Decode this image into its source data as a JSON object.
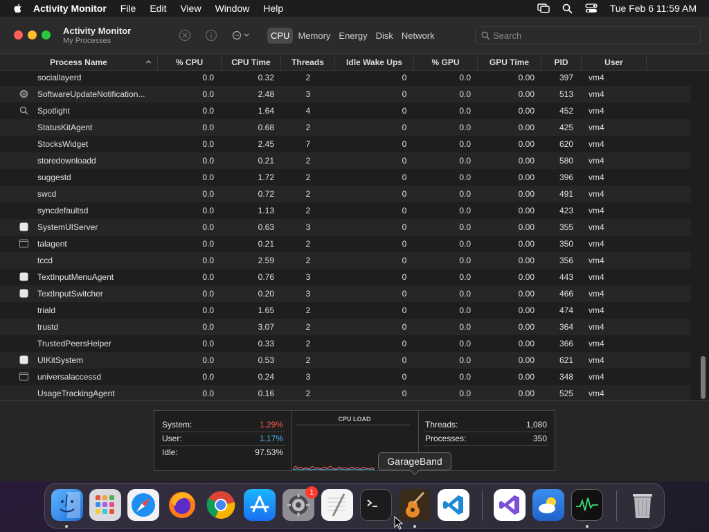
{
  "menubar": {
    "app_name": "Activity Monitor",
    "items": [
      "File",
      "Edit",
      "View",
      "Window",
      "Help"
    ],
    "clock": "Tue Feb 6  11:59 AM"
  },
  "window": {
    "title": "Activity Monitor",
    "subtitle": "My Processes",
    "tabs": [
      "CPU",
      "Memory",
      "Energy",
      "Disk",
      "Network"
    ],
    "active_tab": "CPU",
    "search_placeholder": "Search"
  },
  "columns": [
    "Process Name",
    "% CPU",
    "CPU Time",
    "Threads",
    "Idle Wake Ups",
    "% GPU",
    "GPU Time",
    "PID",
    "User"
  ],
  "rows": [
    {
      "name": "sociallayerd",
      "cpu": "0.0",
      "cpu_time": "0.32",
      "threads": "2",
      "idle": "0",
      "gpu": "0.0",
      "gpu_time": "0.00",
      "pid": "397",
      "user": "vm4",
      "icon": "none"
    },
    {
      "name": "SoftwareUpdateNotification...",
      "cpu": "0.0",
      "cpu_time": "2.48",
      "threads": "3",
      "idle": "0",
      "gpu": "0.0",
      "gpu_time": "0.00",
      "pid": "513",
      "user": "vm4",
      "icon": "gear-icon"
    },
    {
      "name": "Spotlight",
      "cpu": "0.0",
      "cpu_time": "1.64",
      "threads": "4",
      "idle": "0",
      "gpu": "0.0",
      "gpu_time": "0.00",
      "pid": "452",
      "user": "vm4",
      "icon": "magnifier-icon"
    },
    {
      "name": "StatusKitAgent",
      "cpu": "0.0",
      "cpu_time": "0.68",
      "threads": "2",
      "idle": "0",
      "gpu": "0.0",
      "gpu_time": "0.00",
      "pid": "425",
      "user": "vm4",
      "icon": "none"
    },
    {
      "name": "StocksWidget",
      "cpu": "0.0",
      "cpu_time": "2.45",
      "threads": "7",
      "idle": "0",
      "gpu": "0.0",
      "gpu_time": "0.00",
      "pid": "620",
      "user": "vm4",
      "icon": "none"
    },
    {
      "name": "storedownloadd",
      "cpu": "0.0",
      "cpu_time": "0.21",
      "threads": "2",
      "idle": "0",
      "gpu": "0.0",
      "gpu_time": "0.00",
      "pid": "580",
      "user": "vm4",
      "icon": "none"
    },
    {
      "name": "suggestd",
      "cpu": "0.0",
      "cpu_time": "1.72",
      "threads": "2",
      "idle": "0",
      "gpu": "0.0",
      "gpu_time": "0.00",
      "pid": "396",
      "user": "vm4",
      "icon": "none"
    },
    {
      "name": "swcd",
      "cpu": "0.0",
      "cpu_time": "0.72",
      "threads": "2",
      "idle": "0",
      "gpu": "0.0",
      "gpu_time": "0.00",
      "pid": "491",
      "user": "vm4",
      "icon": "none"
    },
    {
      "name": "syncdefaultsd",
      "cpu": "0.0",
      "cpu_time": "1.13",
      "threads": "2",
      "idle": "0",
      "gpu": "0.0",
      "gpu_time": "0.00",
      "pid": "423",
      "user": "vm4",
      "icon": "none"
    },
    {
      "name": "SystemUIServer",
      "cpu": "0.0",
      "cpu_time": "0.63",
      "threads": "3",
      "idle": "0",
      "gpu": "0.0",
      "gpu_time": "0.00",
      "pid": "355",
      "user": "vm4",
      "icon": "app-icon"
    },
    {
      "name": "talagent",
      "cpu": "0.0",
      "cpu_time": "0.21",
      "threads": "2",
      "idle": "0",
      "gpu": "0.0",
      "gpu_time": "0.00",
      "pid": "350",
      "user": "vm4",
      "icon": "window-icon"
    },
    {
      "name": "tccd",
      "cpu": "0.0",
      "cpu_time": "2.59",
      "threads": "2",
      "idle": "0",
      "gpu": "0.0",
      "gpu_time": "0.00",
      "pid": "356",
      "user": "vm4",
      "icon": "none"
    },
    {
      "name": "TextInputMenuAgent",
      "cpu": "0.0",
      "cpu_time": "0.76",
      "threads": "3",
      "idle": "0",
      "gpu": "0.0",
      "gpu_time": "0.00",
      "pid": "443",
      "user": "vm4",
      "icon": "app-icon"
    },
    {
      "name": "TextInputSwitcher",
      "cpu": "0.0",
      "cpu_time": "0.20",
      "threads": "3",
      "idle": "0",
      "gpu": "0.0",
      "gpu_time": "0.00",
      "pid": "466",
      "user": "vm4",
      "icon": "app-icon"
    },
    {
      "name": "triald",
      "cpu": "0.0",
      "cpu_time": "1.65",
      "threads": "2",
      "idle": "0",
      "gpu": "0.0",
      "gpu_time": "0.00",
      "pid": "474",
      "user": "vm4",
      "icon": "none"
    },
    {
      "name": "trustd",
      "cpu": "0.0",
      "cpu_time": "3.07",
      "threads": "2",
      "idle": "0",
      "gpu": "0.0",
      "gpu_time": "0.00",
      "pid": "364",
      "user": "vm4",
      "icon": "none"
    },
    {
      "name": "TrustedPeersHelper",
      "cpu": "0.0",
      "cpu_time": "0.33",
      "threads": "2",
      "idle": "0",
      "gpu": "0.0",
      "gpu_time": "0.00",
      "pid": "366",
      "user": "vm4",
      "icon": "none"
    },
    {
      "name": "UIKitSystem",
      "cpu": "0.0",
      "cpu_time": "0.53",
      "threads": "2",
      "idle": "0",
      "gpu": "0.0",
      "gpu_time": "0.00",
      "pid": "621",
      "user": "vm4",
      "icon": "app-icon"
    },
    {
      "name": "universalaccessd",
      "cpu": "0.0",
      "cpu_time": "0.24",
      "threads": "3",
      "idle": "0",
      "gpu": "0.0",
      "gpu_time": "0.00",
      "pid": "348",
      "user": "vm4",
      "icon": "window-icon"
    },
    {
      "name": "UsageTrackingAgent",
      "cpu": "0.0",
      "cpu_time": "0.16",
      "threads": "2",
      "idle": "0",
      "gpu": "0.0",
      "gpu_time": "0.00",
      "pid": "525",
      "user": "vm4",
      "icon": "none"
    }
  ],
  "stats": {
    "system_label": "System:",
    "system_value": "1.29%",
    "user_label": "User:",
    "user_value": "1.17%",
    "idle_label": "Idle:",
    "idle_value": "97.53%",
    "cpu_load_title": "CPU LOAD",
    "threads_label": "Threads:",
    "threads_value": "1,080",
    "processes_label": "Processes:",
    "processes_value": "350",
    "colors": {
      "system": "#ff5a52",
      "user": "#4fb8f0"
    }
  },
  "tooltip": "GarageBand",
  "dock": {
    "apps": [
      "finder-icon",
      "launchpad-icon",
      "safari-icon",
      "firefox-icon",
      "chrome-icon",
      "app-store-icon",
      "system-settings-icon",
      "textedit-icon",
      "terminal-icon",
      "garageband-icon",
      "vscode-icon",
      "visual-studio-icon",
      "weather-icon",
      "activity-monitor-icon",
      "trash-icon"
    ],
    "settings_badge": "1"
  }
}
